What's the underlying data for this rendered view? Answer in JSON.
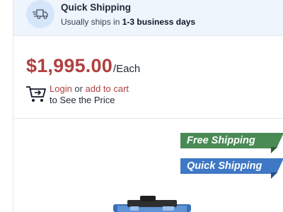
{
  "shipping": {
    "title": "Quick Shipping",
    "subtitle_prefix": "Usually ships in ",
    "subtitle_bold": "1-3 business days",
    "icon": "truck-fast-icon"
  },
  "price": {
    "amount": "$1,995.00",
    "unit": "/Each",
    "color": "#b04040"
  },
  "cart_prompt": {
    "login_label": "Login",
    "or_text": " or ",
    "add_to_cart_label": "add to cart",
    "line2": "to See the Price",
    "icon": "cart-icon"
  },
  "ribbons": {
    "free": {
      "label": "Free Shipping",
      "color": "#4a8a55"
    },
    "quick": {
      "label": "Quick Shipping",
      "color": "#3f78c4"
    }
  },
  "product": {
    "icon": "product-image"
  }
}
